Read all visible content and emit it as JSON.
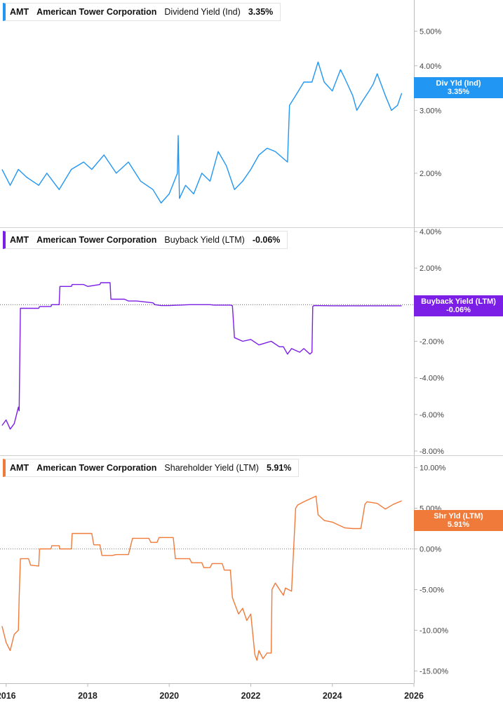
{
  "chart_data": [
    {
      "type": "line",
      "ticker": "AMT",
      "company": "American Tower Corporation",
      "metric": "Dividend Yield (Ind)",
      "current_value": "3.35%",
      "tag_label": "Div Yld (Ind)",
      "tag_value": "3.35%",
      "color": "#2196f3",
      "scale": "log",
      "ylim": [
        1.45,
        5.95
      ],
      "yticks": [
        2,
        3,
        4,
        5
      ],
      "ytick_labels": [
        "2.00%",
        "3.00%",
        "4.00%",
        "5.00%"
      ],
      "series": [
        {
          "x": [
            2015.9,
            2016.1,
            2016.3,
            2016.5,
            2016.8,
            2017.0,
            2017.3,
            2017.6,
            2017.9,
            2018.1,
            2018.4,
            2018.7,
            2019.0,
            2019.3,
            2019.6,
            2019.8,
            2020.0,
            2020.2,
            2020.22,
            2020.25,
            2020.4,
            2020.6,
            2020.8,
            2021.0,
            2021.2,
            2021.4,
            2021.6,
            2021.8,
            2022.0,
            2022.2,
            2022.4,
            2022.6,
            2022.9,
            2022.95,
            2023.1,
            2023.3,
            2023.5,
            2023.65,
            2023.8,
            2024.0,
            2024.2,
            2024.3,
            2024.5,
            2024.6,
            2024.75,
            2024.9,
            2025.0,
            2025.1,
            2025.3,
            2025.45,
            2025.6,
            2025.7
          ],
          "y": [
            2.05,
            1.85,
            2.05,
            1.95,
            1.85,
            2.0,
            1.8,
            2.05,
            2.15,
            2.05,
            2.25,
            2.0,
            2.15,
            1.9,
            1.8,
            1.65,
            1.75,
            2.0,
            2.55,
            1.7,
            1.85,
            1.75,
            2.0,
            1.9,
            2.3,
            2.1,
            1.8,
            1.9,
            2.05,
            2.25,
            2.35,
            2.3,
            2.15,
            3.1,
            3.3,
            3.6,
            3.6,
            4.1,
            3.6,
            3.4,
            3.9,
            3.7,
            3.3,
            3.0,
            3.2,
            3.4,
            3.55,
            3.8,
            3.3,
            3.0,
            3.1,
            3.35
          ]
        }
      ]
    },
    {
      "type": "line",
      "ticker": "AMT",
      "company": "American Tower Corporation",
      "metric": "Buyback Yield (LTM)",
      "current_value": "-0.06%",
      "tag_label": "Buyback Yield (LTM)",
      "tag_value": "-0.06%",
      "color": "#7c1fe6",
      "ylim": [
        -8,
        4
      ],
      "yticks": [
        -8,
        -6,
        -4,
        -2,
        2,
        4
      ],
      "ytick_labels": [
        "-8.00%",
        "-6.00%",
        "-4.00%",
        "-2.00%",
        "2.00%",
        "4.00%"
      ],
      "series": [
        {
          "x": [
            2015.9,
            2016.0,
            2016.1,
            2016.2,
            2016.3,
            2016.32,
            2016.35,
            2016.8,
            2016.82,
            2017.1,
            2017.12,
            2017.3,
            2017.32,
            2017.6,
            2017.62,
            2017.9,
            2018.0,
            2018.3,
            2018.32,
            2018.55,
            2018.57,
            2018.9,
            2019.0,
            2019.2,
            2019.6,
            2019.65,
            2019.8,
            2020.0,
            2020.5,
            2021.0,
            2021.1,
            2021.5,
            2021.55,
            2021.6,
            2021.8,
            2022.0,
            2022.2,
            2022.5,
            2022.7,
            2022.8,
            2022.9,
            2023.0,
            2023.2,
            2023.3,
            2023.45,
            2023.5,
            2023.52,
            2023.55,
            2024.0,
            2025.0,
            2025.7
          ],
          "y": [
            -6.6,
            -6.3,
            -6.8,
            -6.5,
            -5.6,
            -5.8,
            -0.2,
            -0.2,
            -0.1,
            -0.1,
            0.0,
            0.0,
            1.0,
            1.0,
            1.1,
            1.1,
            1.0,
            1.1,
            1.2,
            1.2,
            0.3,
            0.3,
            0.2,
            0.2,
            0.1,
            0.0,
            -0.05,
            -0.05,
            0.0,
            0.0,
            -0.02,
            -0.02,
            -0.06,
            -1.8,
            -2.0,
            -1.9,
            -2.2,
            -2.0,
            -2.3,
            -2.3,
            -2.7,
            -2.4,
            -2.6,
            -2.4,
            -2.7,
            -2.6,
            -0.1,
            -0.05,
            -0.06,
            -0.06,
            -0.06
          ]
        }
      ]
    },
    {
      "type": "line",
      "ticker": "AMT",
      "company": "American Tower Corporation",
      "metric": "Shareholder Yield (LTM)",
      "current_value": "5.91%",
      "tag_label": "Shr Yld (LTM)",
      "tag_value": "5.91%",
      "color": "#f07a3a",
      "ylim": [
        -16,
        11
      ],
      "yticks": [
        -15,
        -10,
        -5,
        0,
        5,
        10
      ],
      "ytick_labels": [
        "-15.00%",
        "-10.00%",
        "-5.00%",
        "0.00%",
        "5.00%",
        "10.00%"
      ],
      "series": [
        {
          "x": [
            2015.9,
            2016.0,
            2016.1,
            2016.2,
            2016.3,
            2016.32,
            2016.35,
            2016.55,
            2016.6,
            2016.8,
            2016.82,
            2017.1,
            2017.12,
            2017.3,
            2017.32,
            2017.6,
            2017.62,
            2018.1,
            2018.15,
            2018.3,
            2018.35,
            2018.6,
            2018.7,
            2019.0,
            2019.1,
            2019.5,
            2019.55,
            2019.7,
            2019.75,
            2020.1,
            2020.15,
            2020.5,
            2020.55,
            2020.8,
            2020.85,
            2021.0,
            2021.05,
            2021.3,
            2021.35,
            2021.5,
            2021.55,
            2021.7,
            2021.8,
            2021.9,
            2022.0,
            2022.1,
            2022.15,
            2022.2,
            2022.3,
            2022.4,
            2022.5,
            2022.52,
            2022.6,
            2022.8,
            2022.85,
            2023.0,
            2023.1,
            2023.15,
            2023.3,
            2023.6,
            2023.65,
            2023.8,
            2024.0,
            2024.3,
            2024.5,
            2024.7,
            2024.8,
            2024.85,
            2025.1,
            2025.3,
            2025.5,
            2025.7
          ],
          "y": [
            -9.5,
            -11.5,
            -12.5,
            -10.5,
            -10.0,
            -6.0,
            -1.2,
            -1.2,
            -2.0,
            -2.1,
            0.0,
            0.0,
            0.4,
            0.4,
            0.0,
            0.0,
            1.9,
            1.9,
            0.5,
            0.5,
            -0.8,
            -0.8,
            -0.7,
            -0.7,
            1.3,
            1.3,
            0.8,
            0.8,
            1.4,
            1.4,
            -1.2,
            -1.2,
            -1.7,
            -1.7,
            -2.3,
            -2.3,
            -1.8,
            -1.8,
            -2.6,
            -2.6,
            -6.0,
            -8.0,
            -7.3,
            -8.8,
            -8.0,
            -13.0,
            -13.7,
            -12.5,
            -13.5,
            -12.8,
            -12.8,
            -5.0,
            -4.2,
            -5.7,
            -4.8,
            -5.2,
            5.0,
            5.4,
            5.8,
            6.5,
            4.2,
            3.5,
            3.3,
            2.6,
            2.5,
            2.5,
            5.5,
            5.8,
            5.6,
            4.9,
            5.5,
            5.91
          ]
        }
      ]
    }
  ],
  "x_axis": {
    "xlim": [
      2015.85,
      2026.0
    ],
    "ticks": [
      2016,
      2018,
      2020,
      2022,
      2024,
      2026
    ],
    "tick_labels": [
      "2016",
      "2018",
      "2020",
      "2022",
      "2024",
      "2026"
    ]
  }
}
